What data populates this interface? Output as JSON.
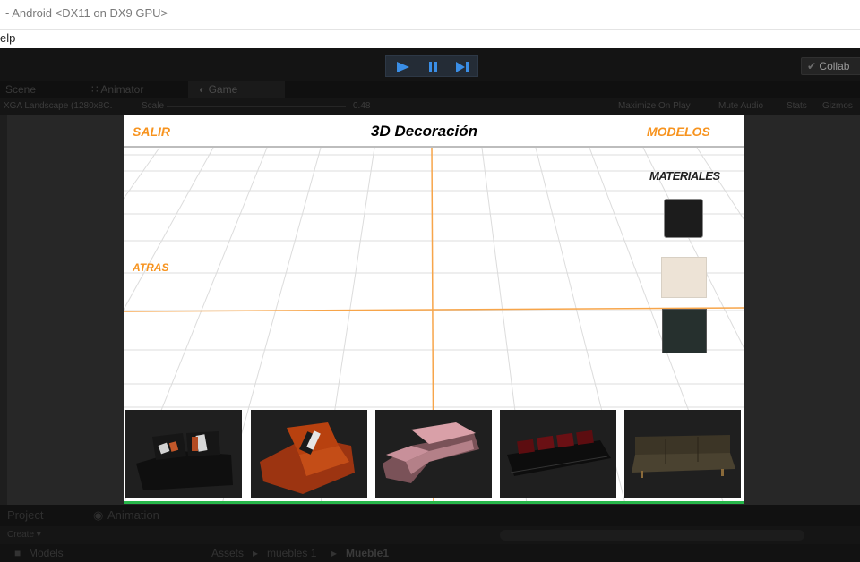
{
  "window": {
    "title": "- Android <DX11 on DX9 GPU>"
  },
  "menubar": {
    "help": "elp"
  },
  "toolbar": {
    "play": "play-icon",
    "pause": "pause-icon",
    "step": "step-icon",
    "collab": "Collab",
    "accent": "#3a8ee6"
  },
  "tabs": {
    "scene": "Scene",
    "animator": "Animator",
    "game": "Game"
  },
  "game_toolbar": {
    "aspect": "XGA Landscape (1280x8C․",
    "scale_label": "Scale",
    "scale_value": "0.48",
    "maximize": "Maximize On Play",
    "mute": "Mute Audio",
    "stats": "Stats",
    "gizmos": "Gizmos"
  },
  "app": {
    "salir": "SALIR",
    "title": "3D Decoración",
    "modelos": "MODELOS",
    "atras": "ATRAS",
    "materiales_title": "MATERIALES",
    "accent": "#f7931e",
    "materials": [
      {
        "name": "black-material",
        "color": "#1c1c1c"
      },
      {
        "name": "cream-material",
        "color": "#ede3d6"
      },
      {
        "name": "dark-leather-material",
        "color": "#26302e"
      }
    ],
    "furniture": [
      {
        "name": "black-sofa-thumbnail"
      },
      {
        "name": "orange-armchair-thumbnail"
      },
      {
        "name": "pink-sectional-thumbnail"
      },
      {
        "name": "red-black-sofa-thumbnail"
      },
      {
        "name": "brown-sofa-thumbnail"
      }
    ]
  },
  "bottom": {
    "project_tab": "Project",
    "animation_tab": "Animation",
    "create": "Create ▾",
    "models_folder": "Models",
    "breadcrumb": [
      "Assets",
      "muebles 1",
      "Mueble1"
    ]
  }
}
